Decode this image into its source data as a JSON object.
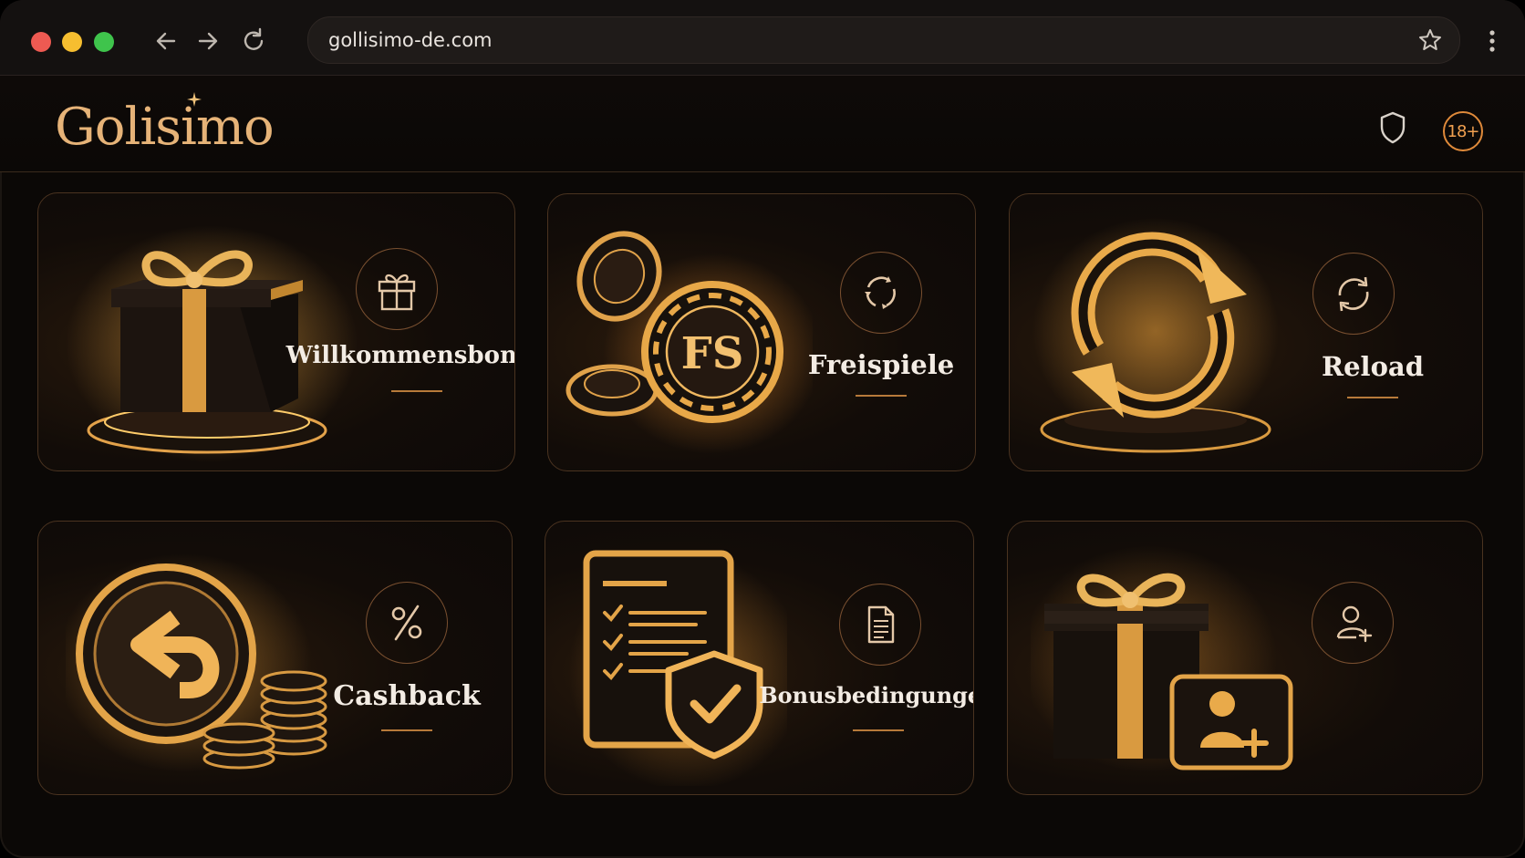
{
  "browser": {
    "url": "gollisimo-de.com",
    "traffic_lights": [
      "#ee5a52",
      "#f6be30",
      "#3fc44c"
    ]
  },
  "site": {
    "logo": "Golisimo",
    "age_badge": "18+"
  },
  "cards": [
    {
      "label": "Willkommensbonus",
      "icon": "gift-icon",
      "art": "gift-box-art"
    },
    {
      "label": "Freispiele",
      "icon": "refresh-dots-icon",
      "art": "fs-chips-art"
    },
    {
      "label": "Reload",
      "icon": "reload-icon",
      "art": "reload-arrows-art"
    },
    {
      "label": "Cashback",
      "icon": "percent-icon",
      "art": "cashback-coin-art"
    },
    {
      "label": "Bonusbedingungen",
      "icon": "document-icon",
      "art": "checklist-shield-art"
    },
    {
      "label": "",
      "icon": "add-user-icon",
      "art": "gift-user-art"
    }
  ],
  "colors": {
    "accent": "#e6b378",
    "gold": "#d79a45",
    "border": "#4a3320",
    "background": "#0b0806"
  }
}
